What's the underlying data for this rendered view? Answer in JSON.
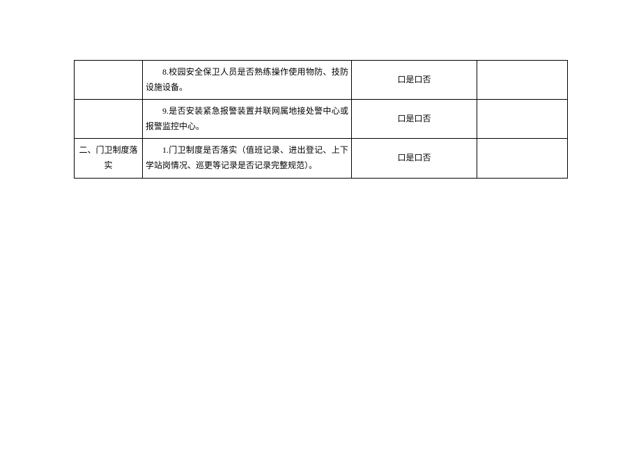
{
  "rows": [
    {
      "category": "",
      "item": "8.校园安全保卫人员是否熟练操作使用物防、技防设施设备。",
      "check": "口是口否",
      "remark": ""
    },
    {
      "category": "",
      "item": "9.是否安装紧急报警装置并联网属地接处警中心或报警监控中心。",
      "check": "口是口否",
      "remark": ""
    },
    {
      "category": "二、门卫制度落实",
      "item": "1.门卫制度是否落实（值班记录、进出登记、上下学站岗情况、巡更等记录是否记录完整规范）。",
      "check": "口是口否",
      "remark": ""
    }
  ]
}
